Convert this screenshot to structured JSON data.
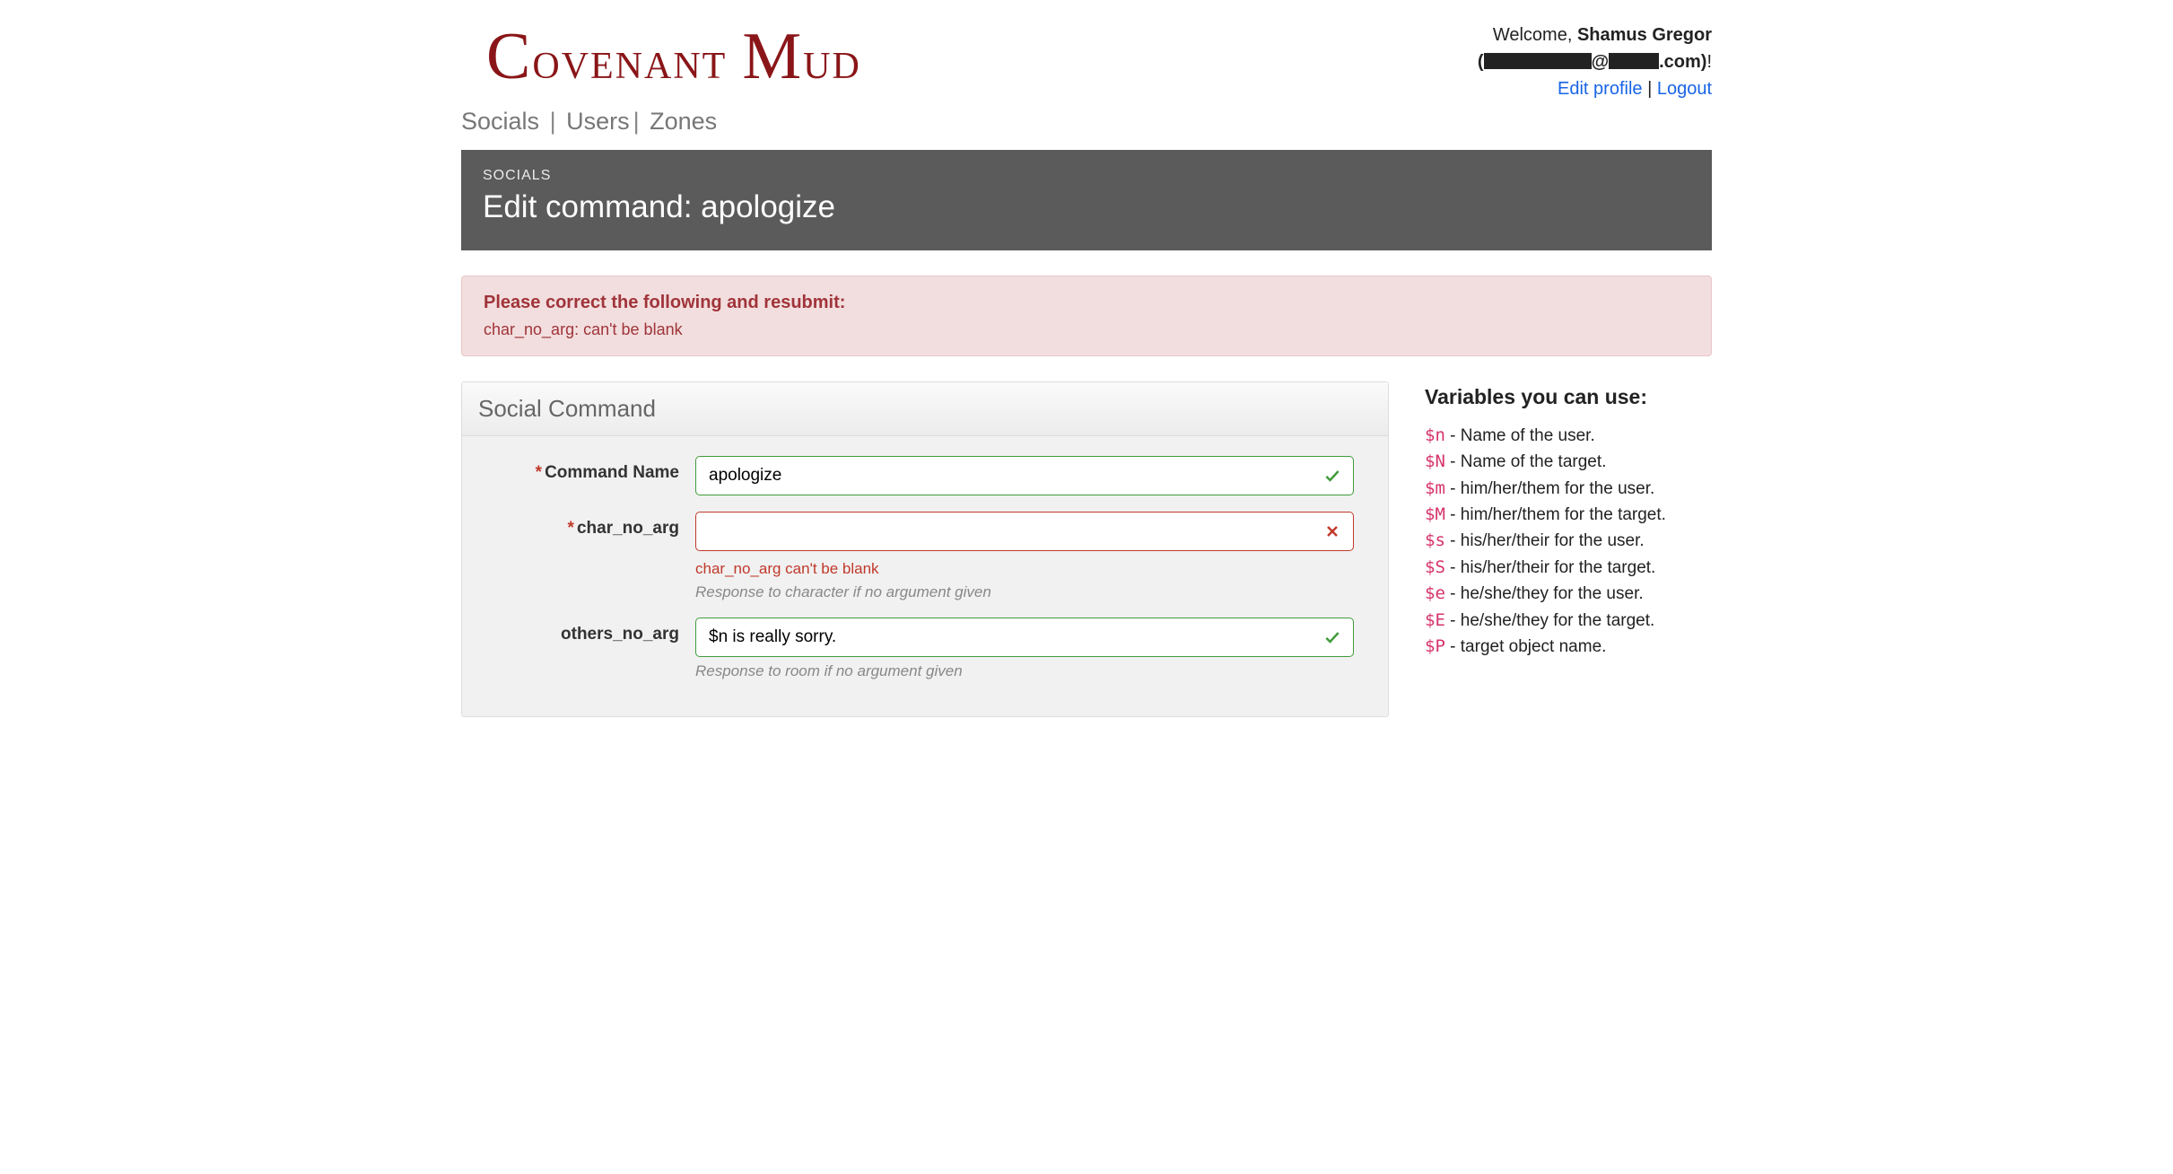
{
  "logo": {
    "word1_initial": "C",
    "word1_rest": "ovenant",
    "word2_initial": "M",
    "word2_rest": "ud"
  },
  "user": {
    "welcome_prefix": "Welcome, ",
    "name": "Shamus Gregor",
    "email_obscured_middle": "@",
    "email_suffix": ".com",
    "paren_close": ")",
    "bang": "!",
    "edit_profile": "Edit profile",
    "sep": " | ",
    "logout": "Logout"
  },
  "nav": {
    "items": [
      "Socials",
      "Users",
      "Zones"
    ]
  },
  "banner": {
    "crumb": "SOCIALS",
    "title": "Edit command: apologize"
  },
  "alert": {
    "head": "Please correct the following and resubmit:",
    "items": [
      "char_no_arg: can't be blank"
    ]
  },
  "panel": {
    "title": "Social Command",
    "fields": {
      "command_name": {
        "label": "Command Name",
        "required": true,
        "value": "apologize",
        "state": "ok"
      },
      "char_no_arg": {
        "label": "char_no_arg",
        "required": true,
        "value": "",
        "state": "err",
        "error": "char_no_arg can't be blank",
        "hint": "Response to character if no argument given"
      },
      "others_no_arg": {
        "label": "others_no_arg",
        "required": false,
        "value": "$n is really sorry.",
        "state": "ok",
        "hint": "Response to room if no argument given"
      }
    }
  },
  "side": {
    "title": "Variables you can use:",
    "vars": [
      {
        "code": "$n",
        "desc": " - Name of the user."
      },
      {
        "code": "$N",
        "desc": " - Name of the target."
      },
      {
        "code": "$m",
        "desc": " - him/her/them for the user."
      },
      {
        "code": "$M",
        "desc": " - him/her/them for the target."
      },
      {
        "code": "$s",
        "desc": " - his/her/their for the user."
      },
      {
        "code": "$S",
        "desc": " - his/her/their for the target."
      },
      {
        "code": "$e",
        "desc": " - he/she/they for the user."
      },
      {
        "code": "$E",
        "desc": " - he/she/they for the target."
      },
      {
        "code": "$P",
        "desc": " - target object name."
      }
    ]
  },
  "req_marker": "*"
}
